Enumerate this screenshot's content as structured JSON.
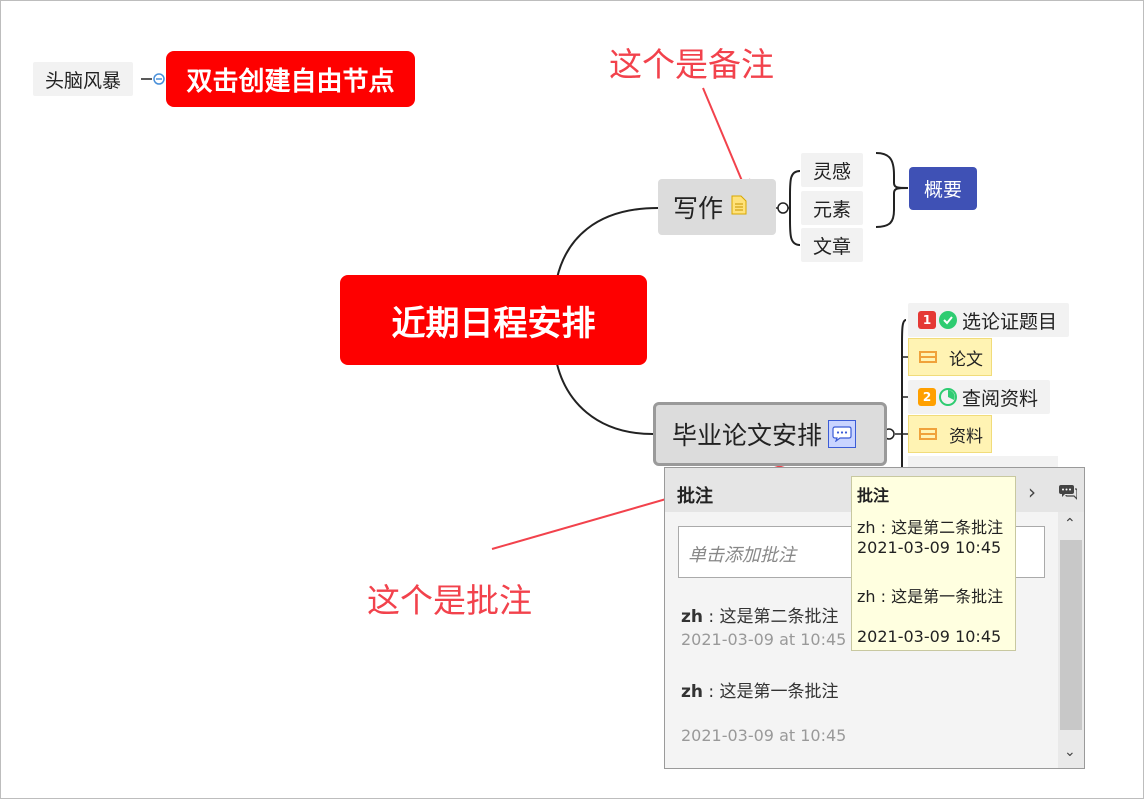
{
  "free_node": {
    "label": "头脑风暴"
  },
  "free_create_hint": "双击创建自由节点",
  "central_topic": "近期日程安排",
  "writing": {
    "label": "写作",
    "subtopics": [
      "灵感",
      "元素",
      "文章"
    ],
    "summary": "概要"
  },
  "thesis": {
    "label": "毕业论文安排",
    "tasks": [
      {
        "priority": "1",
        "priority_color": "#e53935",
        "progress_icon": "check-circle-icon",
        "label": "选论证题目",
        "sub": "论文"
      },
      {
        "priority": "2",
        "priority_color": "#ffa000",
        "progress_icon": "pie-progress-icon",
        "label": "查阅资料",
        "sub": "资料"
      }
    ]
  },
  "annotations": {
    "memo": "这个是备注",
    "comment": "这个是批注"
  },
  "comment_panel": {
    "title": "批注",
    "input_placeholder": "单击添加批注",
    "comments": [
      {
        "author": "zh",
        "text": "这是第二条批注",
        "time": "2021-03-09 at 10:45"
      },
      {
        "author": "zh",
        "text": "这是第一条批注",
        "time": "2021-03-09 at 10:45"
      }
    ]
  },
  "tooltip": {
    "title": "批注",
    "lines": [
      "zh : 这是第二条批注",
      "2021-03-09 10:45",
      "zh : 这是第一条批注",
      "2021-03-09 10:45"
    ]
  },
  "colors": {
    "accent_red": "#fe0000",
    "summary_blue": "#3f51b5",
    "annotation_red": "#f2424c"
  }
}
